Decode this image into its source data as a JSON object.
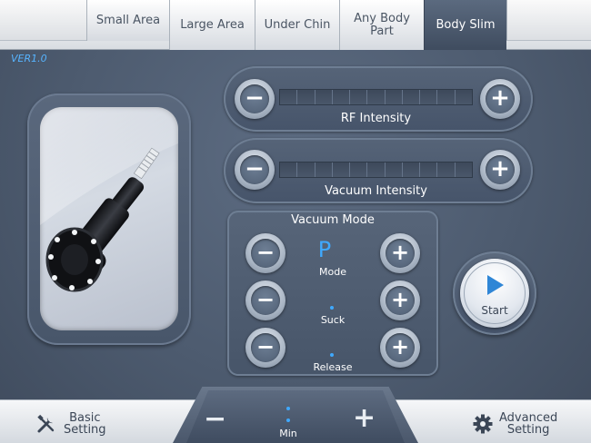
{
  "version": "VER1.0",
  "tabs": [
    {
      "label": "Small Area",
      "active": false
    },
    {
      "label": "Large Area",
      "active": false
    },
    {
      "label": "Under Chin",
      "active": false
    },
    {
      "label": "Any Body\nPart",
      "active": false
    },
    {
      "label": "Body Slim",
      "active": true
    }
  ],
  "rf": {
    "label": "RF Intensity",
    "level_fraction": 0
  },
  "vacuum": {
    "label": "Vacuum Intensity",
    "level_fraction": 0
  },
  "vacuum_mode": {
    "title": "Vacuum Mode",
    "rows": [
      {
        "value": "P",
        "label": "Mode"
      },
      {
        "value": "",
        "label": "Suck"
      },
      {
        "value": "",
        "label": "Release"
      }
    ]
  },
  "start": {
    "label": "Start"
  },
  "bottom": {
    "basic_line1": "Basic",
    "basic_line2": "Setting",
    "advanced_line1": "Advanced",
    "advanced_line2": "Setting",
    "min_label": "Min"
  },
  "colors": {
    "accent": "#3fa9ff",
    "panel": "#4d5b6f",
    "active_tab": "#4a586c"
  }
}
